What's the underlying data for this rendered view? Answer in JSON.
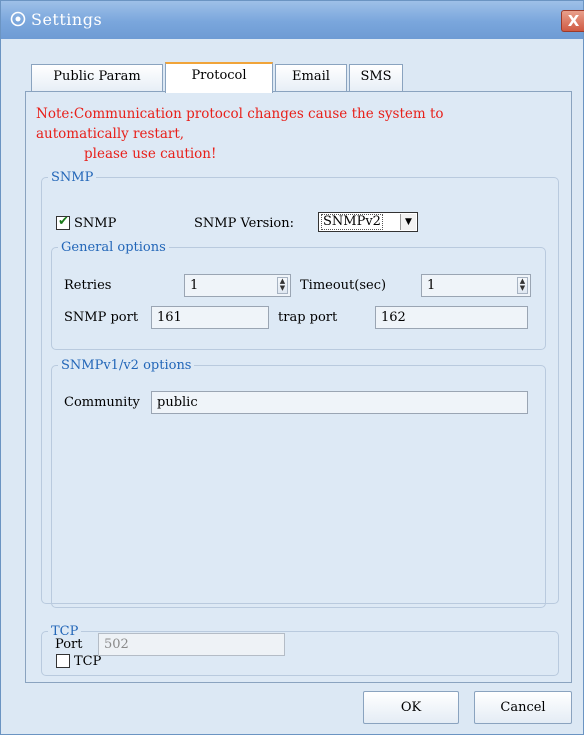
{
  "window": {
    "title": "Settings",
    "close_label": "X"
  },
  "tabs": [
    {
      "label": "Public Param",
      "active": false
    },
    {
      "label": "Protocol",
      "active": true
    },
    {
      "label": "Email",
      "active": false
    },
    {
      "label": "SMS",
      "active": false
    }
  ],
  "note": {
    "line1": "Note:Communication protocol changes cause the system to",
    "line2": "automatically restart,",
    "line3": "please use caution!",
    "color": "#e8201a"
  },
  "snmp": {
    "group_title": "SNMP",
    "enabled_label": "SNMP",
    "enabled": true,
    "version_label": "SNMP Version:",
    "version_value": "SNMPv2",
    "general": {
      "title": "General options",
      "retries_label": "Retries",
      "retries_value": "1",
      "timeout_label": "Timeout(sec)",
      "timeout_value": "1",
      "port_label": "SNMP port",
      "port_value": "161",
      "trap_label": "trap port",
      "trap_value": "162"
    },
    "v1v2": {
      "title": "SNMPv1/v2 options",
      "community_label": "Community",
      "community_value": "public"
    }
  },
  "tcp": {
    "group_title": "TCP",
    "enabled_label": "TCP",
    "enabled": false,
    "port_label": "Port",
    "port_value": "502"
  },
  "buttons": {
    "ok": "OK",
    "cancel": "Cancel"
  },
  "colors": {
    "title_bar": "#7aa6dc",
    "group_title": "#2266b8",
    "active_tab_accent": "#f0a43a"
  }
}
